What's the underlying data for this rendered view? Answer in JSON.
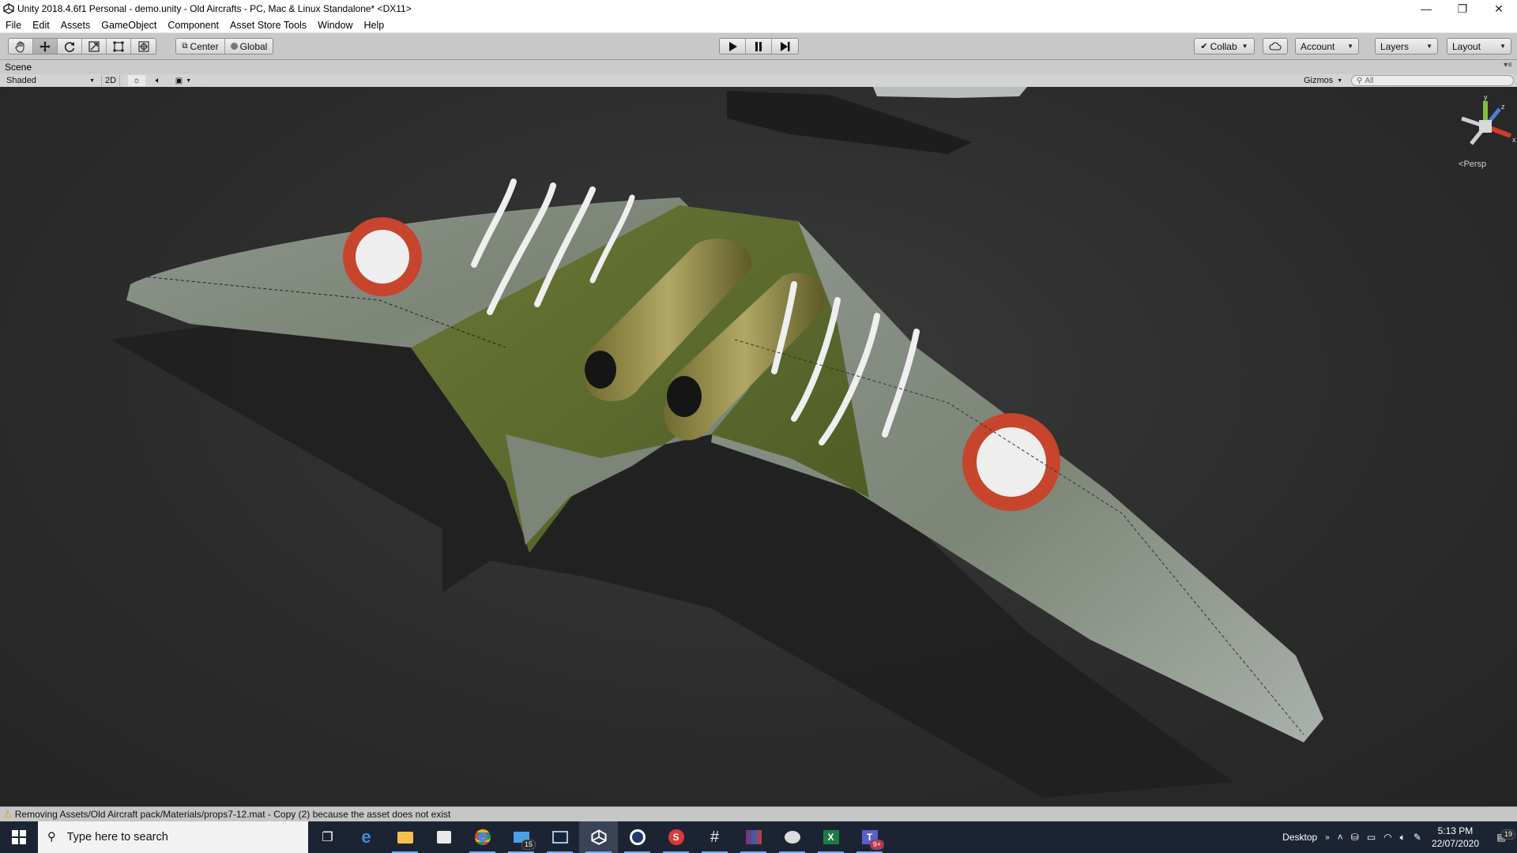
{
  "window": {
    "title": "Unity 2018.4.6f1 Personal - demo.unity - Old Aircrafts - PC, Mac & Linux Standalone* <DX11>",
    "minimize": "—",
    "maximize": "❐",
    "close": "✕"
  },
  "menu": [
    "File",
    "Edit",
    "Assets",
    "GameObject",
    "Component",
    "Asset Store Tools",
    "Window",
    "Help"
  ],
  "toolbar": {
    "tools": [
      "hand-tool",
      "move-tool",
      "rotate-tool",
      "scale-tool",
      "rect-tool",
      "transform-tool"
    ],
    "active_tool": "move-tool",
    "pivot_mode": "Center",
    "pivot_rotation": "Global",
    "collab": "Collab",
    "account": "Account",
    "layers": "Layers",
    "layout": "Layout"
  },
  "scene": {
    "tab_label": "Scene",
    "draw_mode": "Shaded",
    "mode_2d": "2D",
    "gizmos": "Gizmos",
    "search_placeholder": "All",
    "projection": "Persp",
    "axis_x": "x",
    "axis_y": "y",
    "axis_z": "z"
  },
  "status": {
    "message": "Removing Assets/Old Aircraft pack/Materials/props7-12.mat - Copy (2) because the asset does not exist"
  },
  "taskbar": {
    "search_placeholder": "Type here to search",
    "apps": [
      {
        "name": "task-view-icon",
        "badge": ""
      },
      {
        "name": "edge-icon",
        "badge": ""
      },
      {
        "name": "file-explorer-icon",
        "badge": ""
      },
      {
        "name": "store-icon",
        "badge": ""
      },
      {
        "name": "chrome-icon",
        "badge": ""
      },
      {
        "name": "mail-icon",
        "badge": "15"
      },
      {
        "name": "remote-desktop-icon",
        "badge": ""
      },
      {
        "name": "unity-icon",
        "badge": ""
      },
      {
        "name": "cinema4d-icon",
        "badge": ""
      },
      {
        "name": "substance-icon",
        "badge": ""
      },
      {
        "name": "slack-icon",
        "badge": ""
      },
      {
        "name": "winrar-icon",
        "badge": ""
      },
      {
        "name": "paint-icon",
        "badge": ""
      },
      {
        "name": "excel-icon",
        "badge": ""
      },
      {
        "name": "teams-icon",
        "badge": "9+"
      }
    ],
    "desktop_label": "Desktop",
    "time": "5:13 PM",
    "date": "22/07/2020",
    "notification_count": "19"
  },
  "colors": {
    "toolbar_bg": "#c8c8c8",
    "scene_bg": "#2b2b2b",
    "accent_orange": "#f08a3c",
    "taskbar_bg": "#1c2433",
    "roundel_red": "#c6452c",
    "camo_green": "#5c6a2e"
  }
}
